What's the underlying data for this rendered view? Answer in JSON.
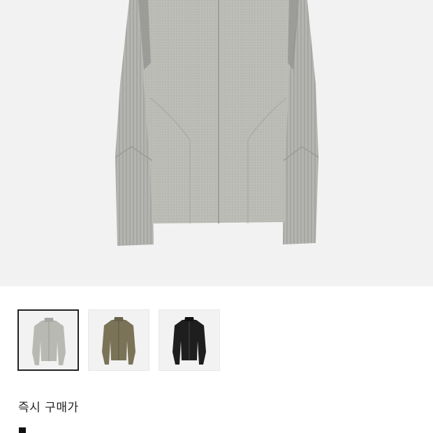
{
  "product": {
    "hero_image_name": "gray-zip-up-ribbed-sleeve-top",
    "thumbnails": [
      {
        "name": "gray",
        "color": "#b9b9b4",
        "selected": true
      },
      {
        "name": "olive",
        "color": "#7b7358",
        "selected": false
      },
      {
        "name": "black",
        "color": "#1e1e1e",
        "selected": false
      }
    ]
  },
  "purchase": {
    "instant_buy_label": "즉시 구매가",
    "price_value": "-"
  },
  "colors": {
    "background": "#ffffff",
    "image_bg": "#f2f2f2",
    "text": "#222222"
  }
}
